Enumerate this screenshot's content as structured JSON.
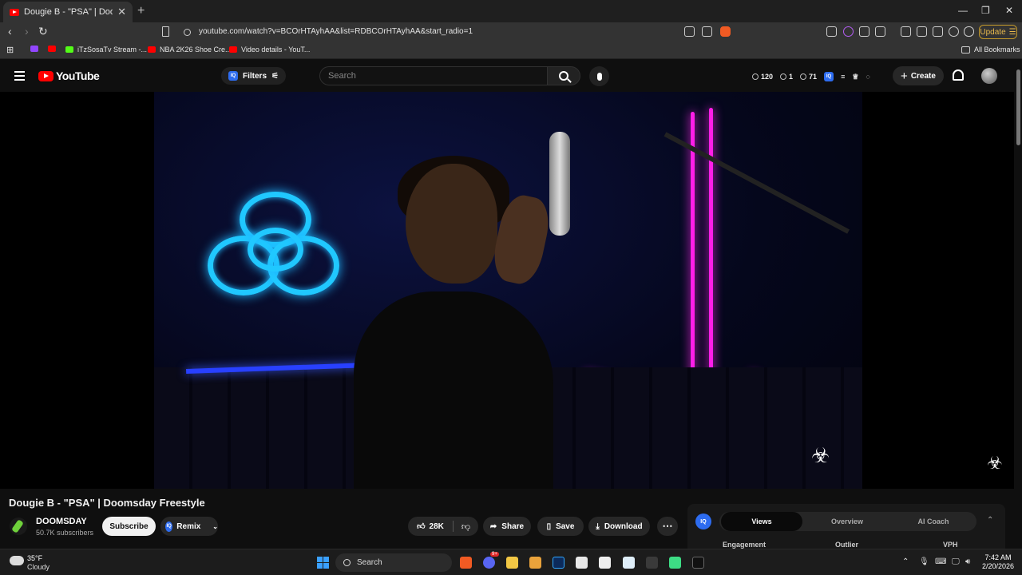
{
  "browser": {
    "tab_title": "Dougie B - \"PSA\" | Doomsday",
    "tab_close": "✕",
    "new_tab": "+",
    "url": "youtube.com/watch?v=BCOrHTAyhAA&list=RDBCOrHTAyhAA&start_radio=1",
    "update_label": "Update",
    "bookmarks": [
      {
        "label": "iTzSosaTv Stream -..."
      },
      {
        "label": "NBA 2K26 Shoe Cre..."
      },
      {
        "label": "Video details - YouT..."
      }
    ],
    "all_bookmarks": "All Bookmarks",
    "shields_count": "1"
  },
  "masthead": {
    "logo_text": "YouTube",
    "filters_label": "Filters",
    "search_placeholder": "Search",
    "stats": [
      {
        "value": "120"
      },
      {
        "value": "1"
      },
      {
        "value": "71"
      }
    ],
    "create_label": "Create"
  },
  "video": {
    "title": "Dougie B - \"PSA\" | Doomsday Freestyle",
    "watermark": "☣"
  },
  "channel": {
    "name": "DOOMSDAY",
    "subscribers": "50.7K subscribers",
    "subscribe_label": "Subscribe",
    "remix_label": "Remix"
  },
  "actions": {
    "like_count": "28K",
    "share_label": "Share",
    "save_label": "Save",
    "download_label": "Download",
    "more_label": "⋯"
  },
  "panel": {
    "badge": "IQ",
    "tabs": [
      {
        "label": "Views",
        "active": true
      },
      {
        "label": "Overview",
        "active": false
      },
      {
        "label": "AI Coach",
        "active": false
      }
    ],
    "columns": [
      "Engagement",
      "Outlier",
      "VPH"
    ]
  },
  "taskbar": {
    "temperature": "35°F",
    "condition": "Cloudy",
    "search_label": "Search",
    "time": "7:42 AM",
    "date": "2/20/2026",
    "discord_badge": "9+"
  },
  "colors": {
    "youtube_red": "#ff0000",
    "accent_blue": "#2d6cf0",
    "update_gold": "#e8b94d",
    "neon_pink": "#ff1ee8",
    "neon_cyan": "#20c8ff"
  }
}
